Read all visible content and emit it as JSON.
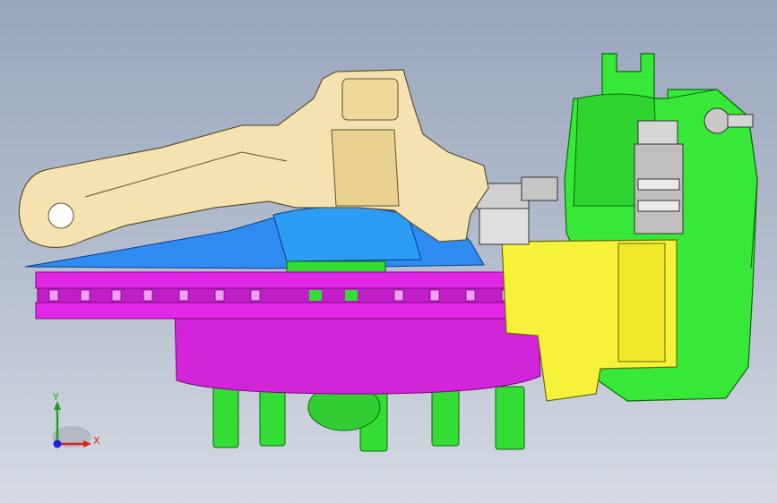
{
  "viewport": {
    "background_top": "#99a6bd",
    "background_bottom": "#d6dbe3"
  },
  "model": {
    "parts": [
      {
        "name": "steering-knuckle",
        "color": "#f4e3b0"
      },
      {
        "name": "brake-disc",
        "color": "#e028e6"
      },
      {
        "name": "dust-shield",
        "color": "#2f8bf0"
      },
      {
        "name": "hub",
        "color": "#e028e6"
      },
      {
        "name": "caliper-body",
        "color": "#33ee33"
      },
      {
        "name": "caliper-bracket",
        "color": "#f6f23a"
      },
      {
        "name": "wheel-studs",
        "color": "#33dd33"
      },
      {
        "name": "fasteners",
        "color": "#c8c8c8"
      }
    ]
  },
  "triad": {
    "x_label": "X",
    "y_label": "Y",
    "x_color": "#e02020",
    "y_color": "#20a020",
    "origin_color": "#2020e0"
  }
}
